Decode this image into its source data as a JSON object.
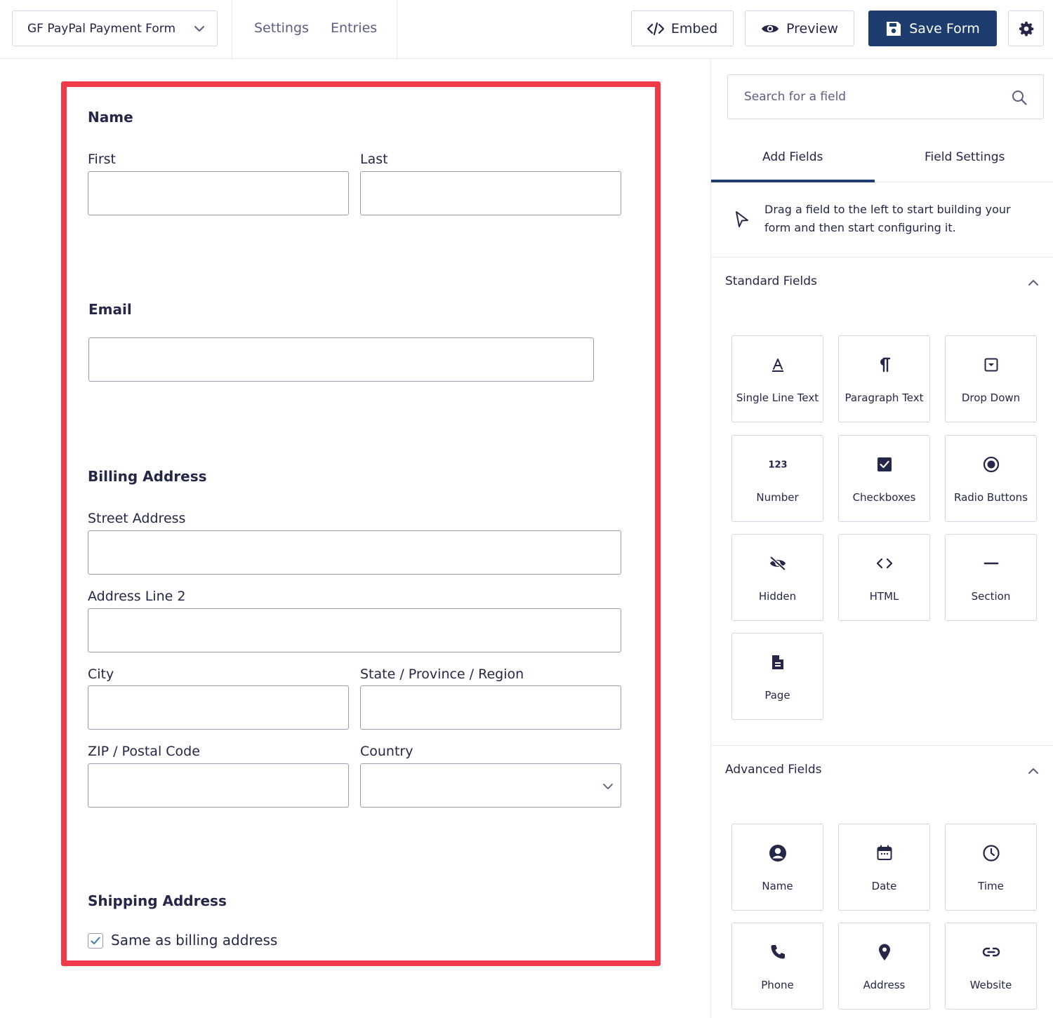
{
  "topbar": {
    "form_name": "GF PayPal Payment Form",
    "links": [
      "Settings",
      "Entries"
    ],
    "embed_label": "Embed",
    "preview_label": "Preview",
    "save_label": "Save Form"
  },
  "form": {
    "name_section": "Name",
    "first_label": "First",
    "last_label": "Last",
    "email_section": "Email",
    "billing_section": "Billing Address",
    "street_label": "Street Address",
    "line2_label": "Address Line 2",
    "city_label": "City",
    "state_label": "State / Province / Region",
    "zip_label": "ZIP / Postal Code",
    "country_label": "Country",
    "shipping_section": "Shipping Address",
    "same_as_billing": "Same as billing address",
    "same_as_billing_checked": true
  },
  "sidebar": {
    "search_placeholder": "Search for a field",
    "tabs": [
      "Add Fields",
      "Field Settings"
    ],
    "hint": "Drag a field to the left to start building your form and then start configuring it.",
    "standard_title": "Standard Fields",
    "standard_fields": [
      {
        "label": "Single Line Text",
        "icon": "text-icon"
      },
      {
        "label": "Paragraph Text",
        "icon": "paragraph-icon"
      },
      {
        "label": "Drop Down",
        "icon": "dropdown-icon"
      },
      {
        "label": "Number",
        "icon": "number-icon"
      },
      {
        "label": "Checkboxes",
        "icon": "checkbox-icon"
      },
      {
        "label": "Radio Buttons",
        "icon": "radio-icon"
      },
      {
        "label": "Hidden",
        "icon": "eye-slash-icon"
      },
      {
        "label": "HTML",
        "icon": "code-icon"
      },
      {
        "label": "Section",
        "icon": "minus-icon"
      },
      {
        "label": "Page",
        "icon": "page-icon"
      }
    ],
    "advanced_title": "Advanced Fields",
    "advanced_fields": [
      {
        "label": "Name",
        "icon": "user-icon"
      },
      {
        "label": "Date",
        "icon": "calendar-icon"
      },
      {
        "label": "Time",
        "icon": "clock-icon"
      },
      {
        "label": "Phone",
        "icon": "phone-icon"
      },
      {
        "label": "Address",
        "icon": "map-pin-icon"
      },
      {
        "label": "Website",
        "icon": "link-icon"
      }
    ]
  },
  "colors": {
    "accent": "#1c3d6e",
    "highlight_border": "#ef3a49",
    "text": "#242748",
    "muted_text": "#5b5e80",
    "border": "#d5d7e9"
  }
}
